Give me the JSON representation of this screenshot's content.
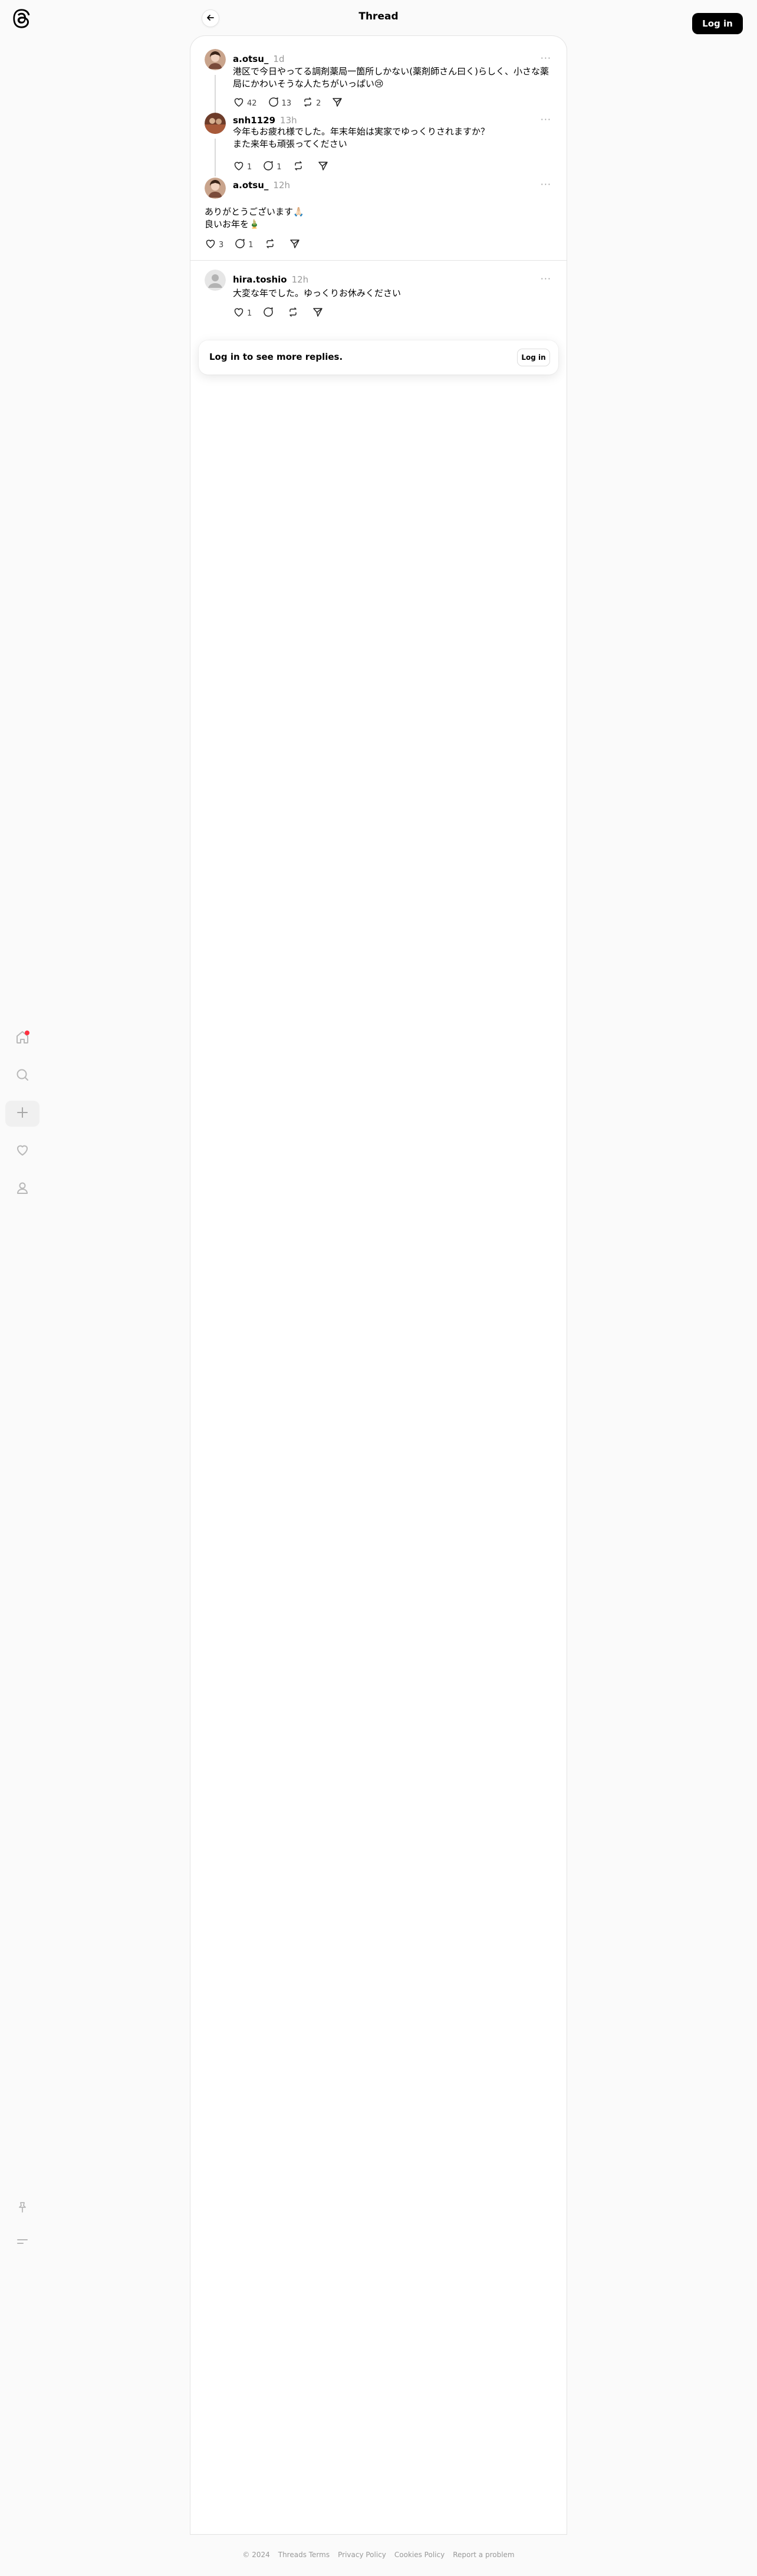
{
  "header": {
    "title": "Thread",
    "login_label": "Log in"
  },
  "rail": {
    "logo": "threads-logo",
    "items": [
      "home-icon",
      "search-icon",
      "create-icon",
      "heart-icon",
      "profile-icon"
    ],
    "bottom": [
      "pin-icon",
      "menu-icon"
    ],
    "notification_color": "#ff3040"
  },
  "posts": [
    {
      "username": "a.otsu_",
      "time": "1d",
      "text": "港区で今日やってる調剤薬局一箇所しかない(薬剤師さん曰く)らしく、小さな薬局にかわいそうな人たちがいっぱい😢",
      "likes": "42",
      "replies": "13",
      "reposts": "2"
    },
    {
      "username": "snh1129",
      "time": "13h",
      "text_lines": [
        "今年もお疲れ様でした。年末年始は実家でゆっくりされますか？",
        "また来年も頑張ってください"
      ],
      "likes": "1",
      "replies": "1"
    },
    {
      "username": "a.otsu_",
      "time": "12h",
      "text_lines": [
        "ありがとうございます🙏🏻",
        "良いお年を🎍"
      ],
      "likes": "3",
      "replies": "1"
    },
    {
      "username": "hira.toshio",
      "time": "12h",
      "text": "大変な年でした。ゆっくりお休みください",
      "likes": "1"
    }
  ],
  "login_card": {
    "text": "Log in to see more replies.",
    "button": "Log in"
  },
  "footer": {
    "copyright": "© 2024",
    "links": [
      "Threads Terms",
      "Privacy Policy",
      "Cookies Policy",
      "Report a problem"
    ]
  }
}
